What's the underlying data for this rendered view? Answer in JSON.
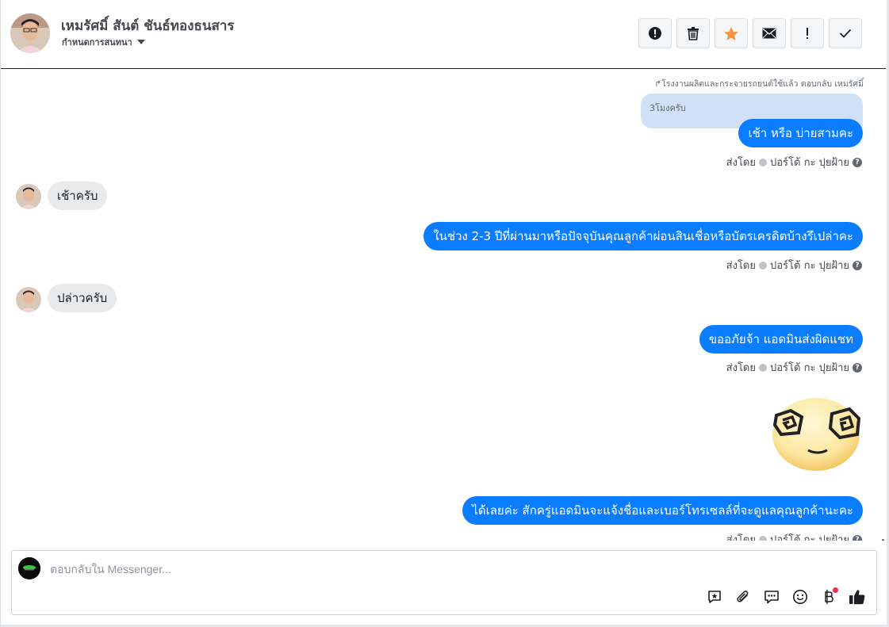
{
  "header": {
    "contact_name": "เหมรัศมิ์ สันต์ ชันธ์ทองธนสาร",
    "subtitle": "กำหนดการสนทนา",
    "toolbar_icons": [
      "alert-circle-icon",
      "trash-icon",
      "star-icon",
      "envelope-icon",
      "exclamation-icon",
      "checkmark-icon"
    ],
    "star_color": "#f7923b"
  },
  "thread": {
    "reply_note": "↱โรงงานผลิตและกระจายรถยนต์ใช้แล้ว ตอบกลับ เหมรัศมิ์",
    "quoted_text": "3โมงครับ",
    "sent_by_label": "ส่งโดย",
    "sender_name": "ปอร์โต้ กะ ปุยฝ้าย",
    "messages": [
      {
        "direction": "out",
        "text": "เช้า หรือ บ่ายสามคะ"
      },
      {
        "direction": "in",
        "text": "เช้าครับ"
      },
      {
        "direction": "out",
        "text": "ในช่วง 2-3 ปีที่ผ่านมาหรือปัจจุบันคุณลูกค้าผ่อนสินเชื่อหรือบัตรเครดิตบ้างรึเปล่าคะ"
      },
      {
        "direction": "in",
        "text": "ปล่าวครับ"
      },
      {
        "direction": "out",
        "text": "ขออภัยจ้า แอดมินส่งผิดแชท"
      },
      {
        "direction": "out",
        "sticker": "dizzy-face-sticker"
      },
      {
        "direction": "out",
        "text": "ได้เลยค่ะ สักครู่แอดมินจะแจ้งชื่อและเบอร์โทรเซลล์ที่จะดูแลคุณลูกค้านะคะ"
      }
    ]
  },
  "composer": {
    "placeholder": "ตอบกลับใน Messenger...",
    "value": "",
    "icons": [
      "saved-reply-icon",
      "attachment-icon",
      "chat-bubbles-icon",
      "emoji-icon",
      "baht-payment-icon",
      "like-icon"
    ]
  },
  "colors": {
    "outgoing_bubble": "#0a7cff",
    "incoming_bubble": "#e9eaeb",
    "quoted_bubble": "#cfe0f7"
  }
}
